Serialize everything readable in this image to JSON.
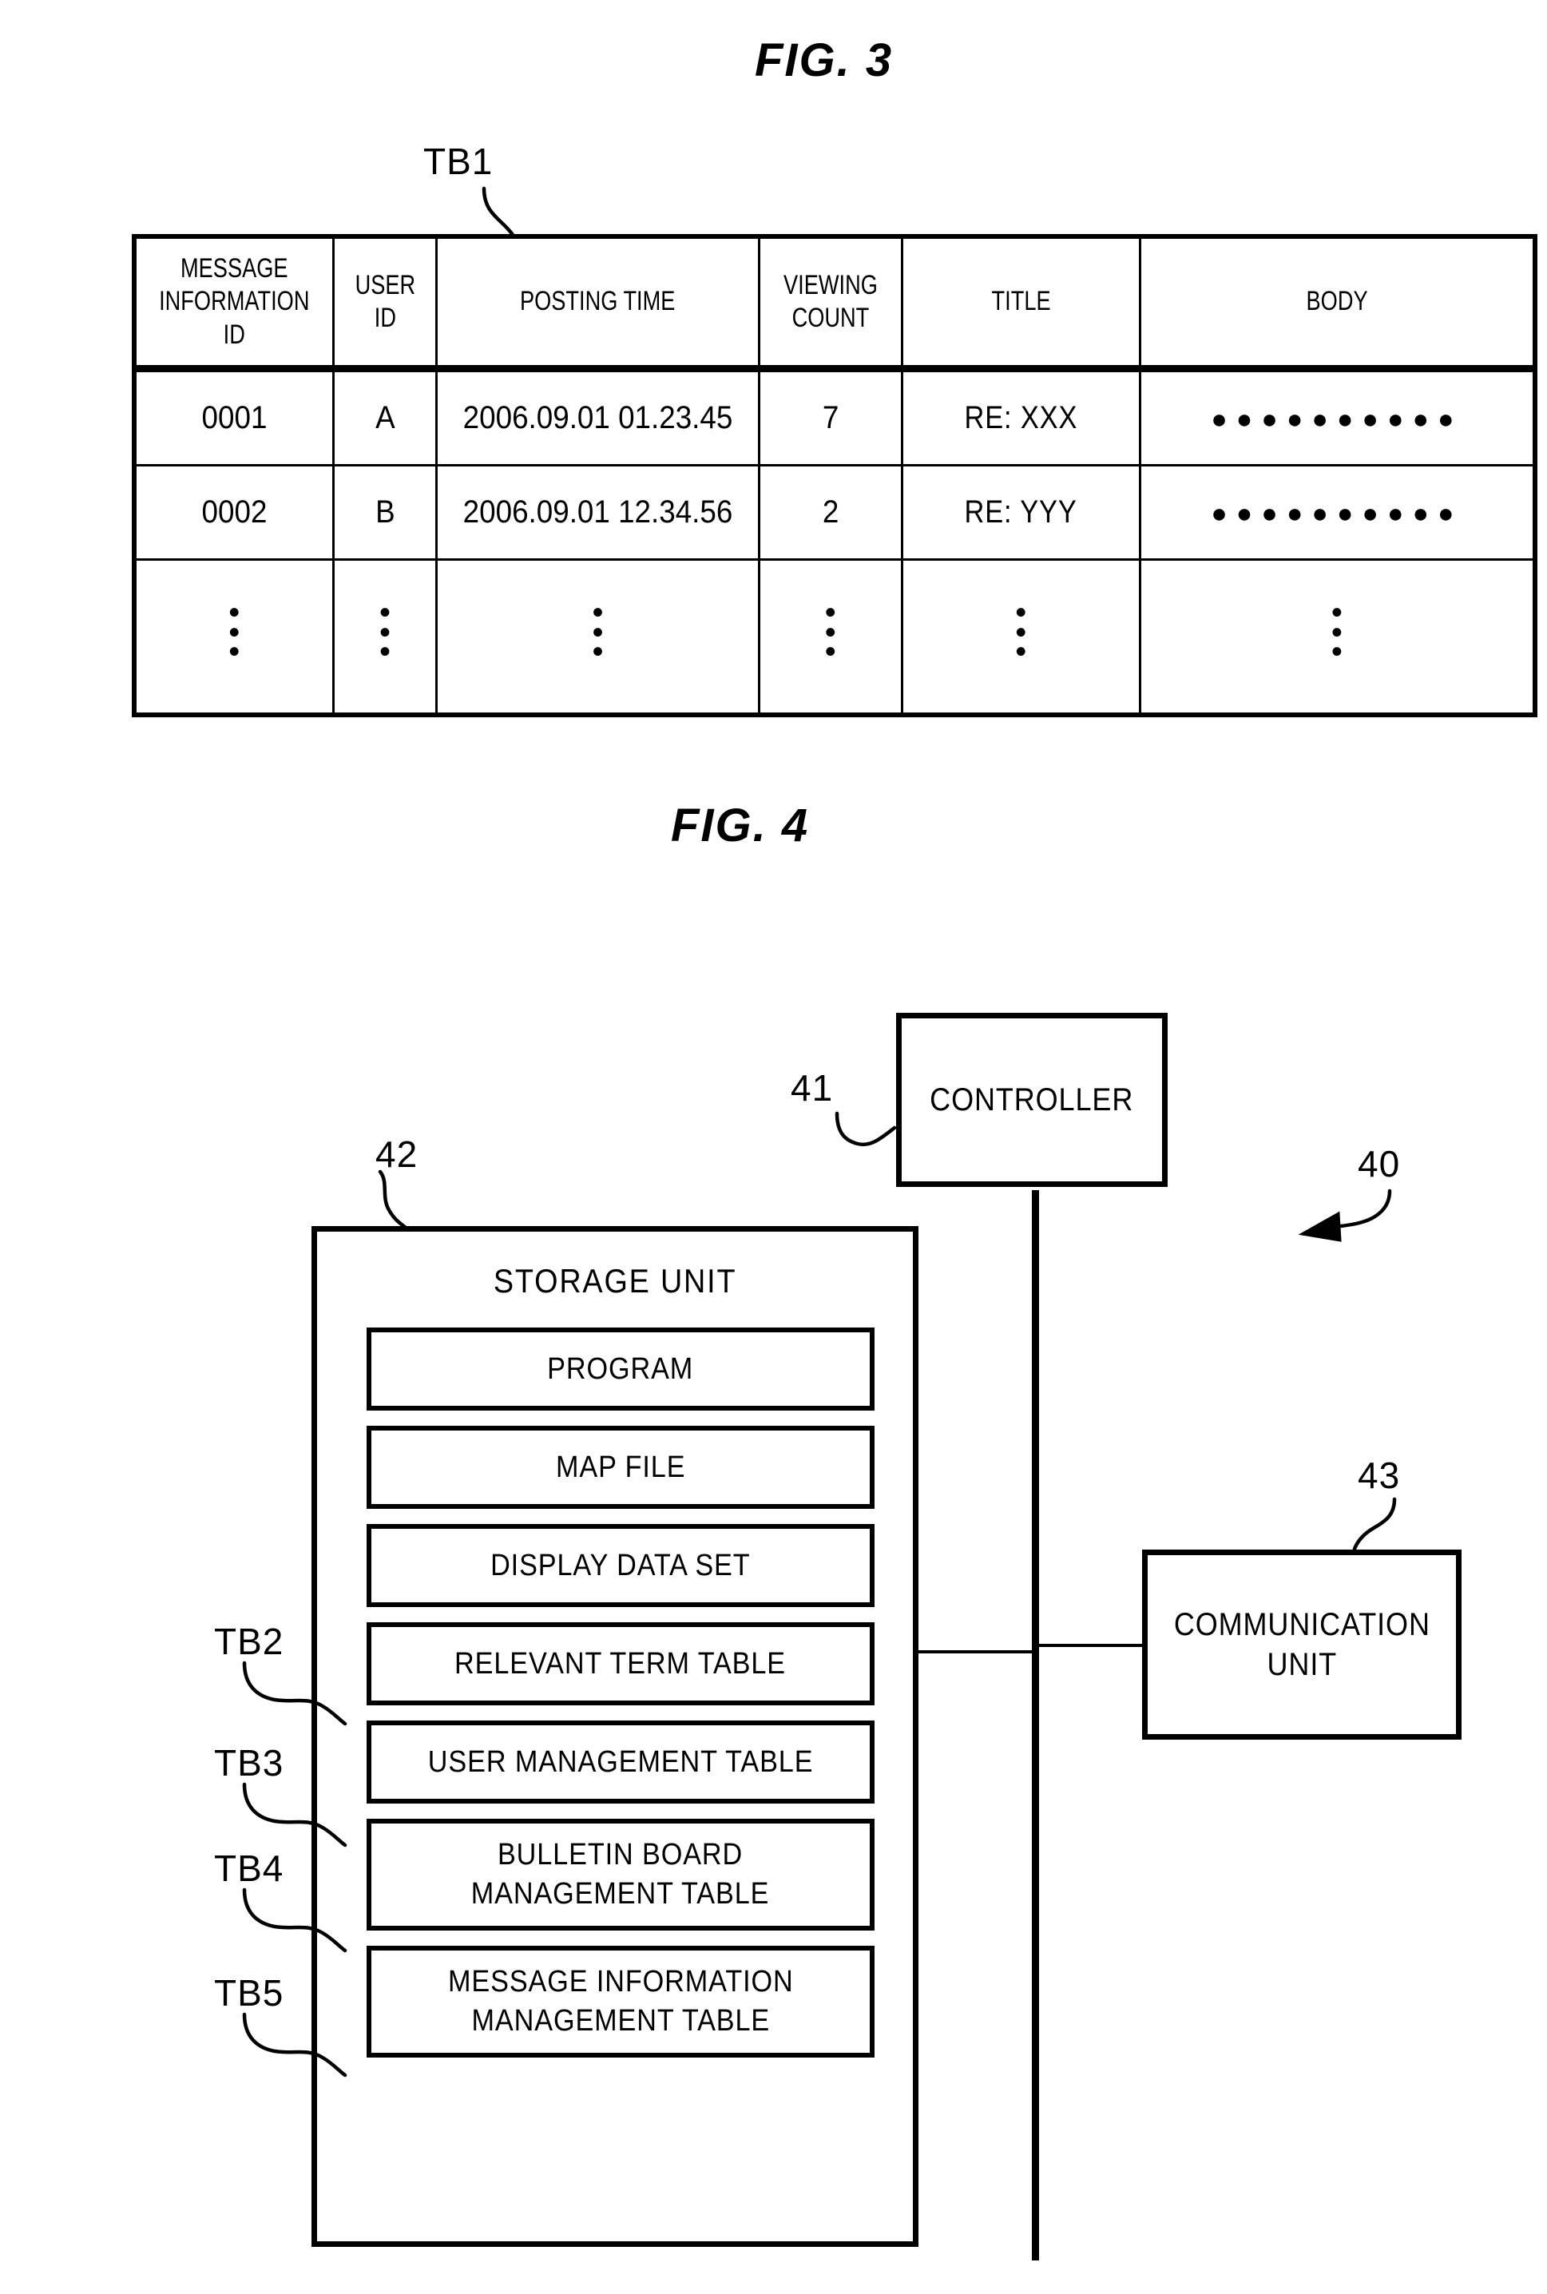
{
  "figures": {
    "fig3": {
      "title": "FIG. 3",
      "table_ref_label": "TB1",
      "table": {
        "headers": [
          "MESSAGE\nINFORMATION\nID",
          "USER\nID",
          "POSTING TIME",
          "VIEWING\nCOUNT",
          "TITLE",
          "BODY"
        ],
        "rows": [
          {
            "message_information_id": "0001",
            "user_id": "A",
            "posting_time": "2006.09.01 01.23.45",
            "viewing_count": "7",
            "title": "RE: XXX",
            "body": "●●●●●●●●●●"
          },
          {
            "message_information_id": "0002",
            "user_id": "B",
            "posting_time": "2006.09.01 12.34.56",
            "viewing_count": "2",
            "title": "RE: YYY",
            "body": "●●●●●●●●●●"
          }
        ],
        "continuation_row": {
          "message_information_id": "•\n•\n•",
          "user_id": "•\n•\n•",
          "posting_time": "•\n•\n•",
          "viewing_count": "•\n•\n•",
          "title": "•\n•\n•",
          "body": "•\n•\n•"
        }
      }
    },
    "fig4": {
      "title": "FIG. 4",
      "system_ref_label": "40",
      "controller": {
        "label": "CONTROLLER",
        "ref_label": "41"
      },
      "storage_unit": {
        "label": "STORAGE UNIT",
        "ref_label": "42",
        "items": [
          {
            "label": "PROGRAM",
            "ref_label": ""
          },
          {
            "label": "MAP FILE",
            "ref_label": ""
          },
          {
            "label": "DISPLAY DATA SET",
            "ref_label": ""
          },
          {
            "label": "RELEVANT TERM TABLE",
            "ref_label": "TB2"
          },
          {
            "label": "USER MANAGEMENT TABLE",
            "ref_label": "TB3"
          },
          {
            "label": "BULLETIN BOARD\nMANAGEMENT TABLE",
            "ref_label": "TB4"
          },
          {
            "label": "MESSAGE INFORMATION\nMANAGEMENT TABLE",
            "ref_label": "TB5"
          }
        ]
      },
      "communication_unit": {
        "label": "COMMUNICATION\nUNIT",
        "ref_label": "43"
      }
    }
  },
  "colors": {
    "ink": "#000000",
    "paper": "#ffffff"
  }
}
